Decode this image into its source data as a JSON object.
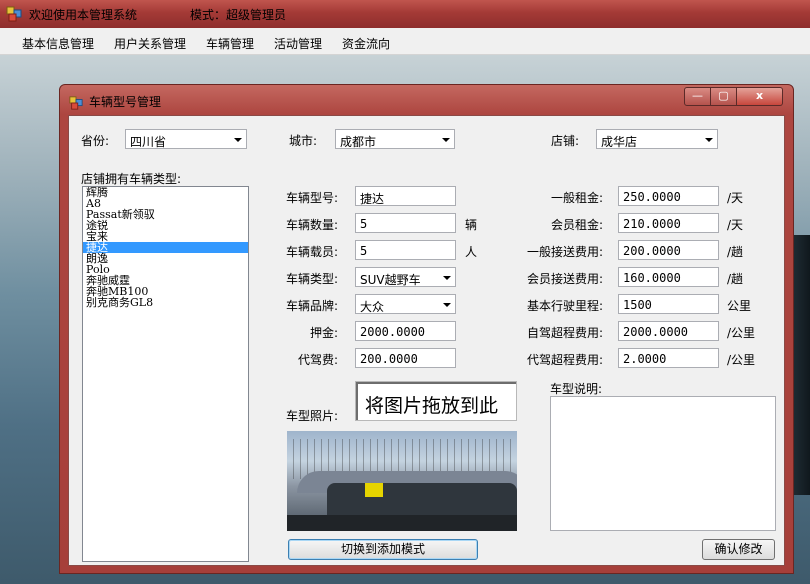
{
  "app": {
    "title": "欢迎使用本管理系统",
    "mode": "模式：超级管理员"
  },
  "menu": [
    "基本信息管理",
    "用户关系管理",
    "车辆管理",
    "活动管理",
    "资金流向"
  ],
  "dialog": {
    "title": "车辆型号管理",
    "window_buttons": {
      "minimize": "—",
      "maximize": "▢",
      "close": "x"
    }
  },
  "location": {
    "province_label": "省份:",
    "province": "四川省",
    "city_label": "城市:",
    "city": "成都市",
    "store_label": "店铺:",
    "store": "成华店"
  },
  "car_list": {
    "label": "店铺拥有车辆类型:",
    "items": [
      "辉腾",
      "A8",
      "Passat新领驭",
      "途锐",
      "宝来",
      "捷达",
      "朗逸",
      "Polo",
      "奔驰威霆",
      "奔驰MB100",
      "别克商务GL8"
    ],
    "selected_index": 5
  },
  "car_form": {
    "model_label": "车辆型号:",
    "model": "捷达",
    "quantity_label": "车辆数量:",
    "quantity": "5",
    "quantity_unit": "辆",
    "seats_label": "车辆载员:",
    "seats": "5",
    "seats_unit": "人",
    "type_label": "车辆类型:",
    "type": "SUV越野车",
    "brand_label": "车辆品牌:",
    "brand": "大众",
    "deposit_label": "押金:",
    "deposit": "2000.0000",
    "driver_fee_label": "代驾费:",
    "driver_fee": "200.0000",
    "photo_label": "车型照片:",
    "dropzone_text": "将图片拖放到此"
  },
  "pricing": {
    "rows": [
      {
        "label": "一般租金:",
        "value": "250.0000",
        "unit": "/天"
      },
      {
        "label": "会员租金:",
        "value": "210.0000",
        "unit": "/天"
      },
      {
        "label": "一般接送费用:",
        "value": "200.0000",
        "unit": "/趟"
      },
      {
        "label": "会员接送费用:",
        "value": "160.0000",
        "unit": "/趟"
      },
      {
        "label": "基本行驶里程:",
        "value": "1500",
        "unit": "公里"
      },
      {
        "label": "自驾超程费用:",
        "value": "2000.0000",
        "unit": "/公里"
      },
      {
        "label": "代驾超程费用:",
        "value": "2.0000",
        "unit": "/公里"
      }
    ],
    "description_label": "车型说明:",
    "description": ""
  },
  "buttons": {
    "switch_mode": "切换到添加模式",
    "confirm": "确认修改"
  },
  "colors": {
    "titlebar": "#a43a36",
    "selection": "#3399ff"
  }
}
